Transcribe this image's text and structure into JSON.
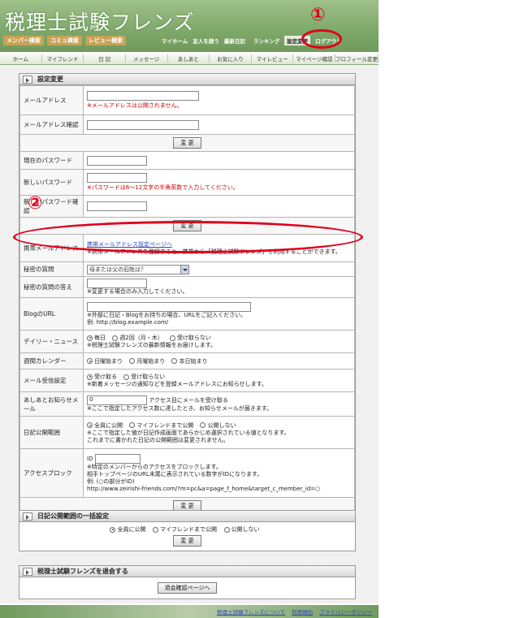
{
  "header": {
    "site_title": "税理士試験フレンズ",
    "search_buttons": [
      "メンバー検索",
      "コミュ検索",
      "レビュー検索"
    ],
    "nav1": [
      "マイホーム",
      "友人を誘う",
      "最新日記",
      "ランキング",
      "設定変更",
      "ログアウト"
    ],
    "selected": "設定変更"
  },
  "nav2": [
    "ホーム",
    "マイフレンド",
    "日 記",
    "メッセージ",
    "あしあと",
    "お気に入り",
    "マイレビュー",
    "マイページ確認",
    "プロフィール変更"
  ],
  "annotations": {
    "one": "①",
    "two": "②"
  },
  "settings_panel": {
    "heading": "設定変更",
    "mail_label": "メールアドレス",
    "mail_note": "※メールアドレスは公開されません。",
    "mail_confirm_label": "メールアドレス確認",
    "change_button": "変 更",
    "current_pw_label": "現在のパスワード",
    "new_pw_label": "新しいパスワード",
    "new_pw_note": "※パスワードは6～12文字の半角英数で入力してください。",
    "new_pw_confirm_label": "新しいパスワード確認",
    "mobile_label": "携帯メールアドレス",
    "mobile_link": "携帯メールアドレス設定ページへ",
    "mobile_note": "※携帯メールアドレスを登録すると、携帯から「税理士試験フレンズ」を利用することができます。",
    "secret_q_label": "秘密の質問",
    "secret_q_value": "母または父の旧姓は？",
    "secret_a_label": "秘密の質問の答え",
    "secret_a_note": "※変更する場合のみ入力してください。",
    "blog_label": "BlogのURL",
    "blog_note1": "※外部に日記・Blogをお持ちの場合、URLをご記入ください。",
    "blog_note2": "例: http://blog.example.com/",
    "daily_label": "デイリー・ニュース",
    "daily_options": [
      "毎日",
      "週2回（月・木）",
      "受け取らない"
    ],
    "daily_note": "※税理士試験フレンズの最新情報をお届けします。",
    "calendar_label": "週間カレンダー",
    "calendar_options": [
      "日曜始まり",
      "月曜始まり",
      "本日始まり"
    ],
    "mailrecv_label": "メール受信設定",
    "mailrecv_options": [
      "受け取る",
      "受け取らない"
    ],
    "mailrecv_note": "※新着メッセージの通知などを登録メールアドレスにお知らせします。",
    "ashiato_label": "あしあとお知らせメール",
    "ashiato_value": "0",
    "ashiato_suffix": "アクセス目にメールを受け取る",
    "ashiato_note": "※ここで指定したアクセス数に達したとき、お知らせメールが届きます。",
    "diary_label": "日記公開範囲",
    "diary_options": [
      "全員に公開",
      "マイフレンドまで公開",
      "公開しない"
    ],
    "diary_note1": "※ここで指定した値が日記作成画面であらかじめ選択されている値となります。",
    "diary_note2": "これまでに書かれた日記の公開範囲は変更されません。",
    "block_label": "アクセスブロック",
    "block_id_label": "ID",
    "block_note1": "※特定のメンバーからのアクセスをブロックします。",
    "block_note2": "相手トップページのURL末尾に表示されている数字がIDになります。",
    "block_note3": "例: (○の部分がID)",
    "block_note4": "http://www.zeirishi-friends.com/?m=pc&a=page_f_home&target_c_member_id=○"
  },
  "diary_panel": {
    "heading": "日記公開範囲の一括設定",
    "options": [
      "全員に公開",
      "マイフレンドまで公開",
      "公開しない"
    ],
    "button": "変 更"
  },
  "withdraw_panel": {
    "heading": "税理士試験フレンズを退会する",
    "button": "退会確認ページへ"
  },
  "footer": {
    "links": [
      "税理士試験フレンズについて",
      "利用規約",
      "プライバシーポリシー"
    ]
  }
}
